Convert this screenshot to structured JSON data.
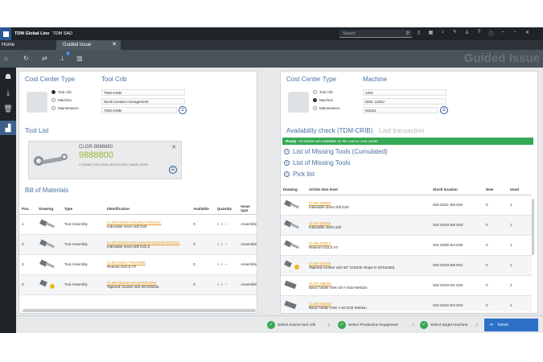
{
  "window": {
    "app_title": "TDM Global Line",
    "app_subtitle": "TDM SAD",
    "search_placeholder": "Search"
  },
  "tabs": {
    "home": "Home",
    "active": "Guided Issue",
    "active_close": "✕"
  },
  "toolbar": {
    "page_title": "Guided Issue",
    "badge": "1"
  },
  "left": {
    "cost_center_heading": "Cost Center Type",
    "tool_crib_heading": "Tool Crib",
    "radio_options": [
      "Tool crib",
      "Machine",
      "Maintenance"
    ],
    "selected_radio": 0,
    "fields": [
      "TDM-CRIB",
      "Stock location management",
      "TDM-CRIB"
    ],
    "tool_list_heading": "Tool List",
    "tool_list": {
      "code": "CLGR-9888880",
      "number": "9888800",
      "description": "CONNECTING ROD MERCEDES OM651 W204",
      "close": "✕"
    },
    "bom_heading": "Bill of Materials",
    "bom_columns": [
      "Pos.",
      "Drawing",
      "Type",
      "Identification",
      "Available",
      "Quantity",
      "Issue type"
    ],
    "bom_rows": [
      {
        "pos": "1",
        "type": "Tool Assembly",
        "id_link": "CLGR-D0015-HOLEPLATEDRILL",
        "id_desc": "Indexable insert drill D28",
        "available": "0",
        "qty": "1",
        "issue": "Assemble"
      },
      {
        "pos": "2",
        "type": "Tool Assembly",
        "id_link": "CLGR-D0016-EXCHANGEABLEHEADDRILL",
        "id_desc": "Indexable insert drill D31.5",
        "available": "0",
        "qty": "1",
        "issue": "Assemble"
      },
      {
        "pos": "3",
        "type": "Tool Assembly",
        "id_link": "CLGR-D0017-REAMER",
        "id_desc": "Reamer D31.5 H7",
        "available": "0",
        "qty": "1",
        "issue": "Assemble"
      },
      {
        "pos": "4",
        "type": "Tool Assembly",
        "id_link": "CLGR-D0018-COUNTERSINK",
        "id_desc": "Tapered counter sink 90 DIN335",
        "available": "0",
        "qty": "1",
        "issue": "Assemble"
      }
    ]
  },
  "right": {
    "cost_center_heading": "Cost Center Type",
    "machine_heading": "Machine",
    "radio_options": [
      "Tool crib",
      "Machine",
      "Maintenance"
    ],
    "selected_radio": 1,
    "fields": [
      "1001",
      "DMC 1150V",
      "M1001"
    ],
    "availability_heading": "Availability check (TDM-CRIB)",
    "last_transaction": "Last transaction",
    "ready_label": "Ready",
    "ready_text": "All articles are available on the source cost centre",
    "missing_cumulated": "List of Missing Tools (Cumulated)",
    "missing": "List of Missing Tools",
    "pick_list": "Pick list",
    "pick_columns": [
      "Drawing",
      "Article item level",
      "Stock location",
      "New",
      "Used"
    ],
    "pick_rows": [
      {
        "link": "CLGR-D0015",
        "desc": "Indexable insert drill D28",
        "loc": "S02 D021 W5 D04",
        "new": "0",
        "used": "1"
      },
      {
        "link": "CLGR-D0016",
        "desc": "Indexable insert drill",
        "loc": "S02 D048 W8 D03",
        "new": "0",
        "used": "1"
      },
      {
        "link": "CLGR-D0017",
        "desc": "Reamer D31.5 H7",
        "loc": "S01 D006 W4 D05",
        "new": "0",
        "used": "1"
      },
      {
        "link": "CLGR-D0018",
        "desc": "Tapered counter sink 90° DIN335 shape D (DIN2288)",
        "loc": "S02 D049 W9 D01",
        "new": "0",
        "used": "1"
      },
      {
        "link": "CLGR-HB006",
        "desc": "Basic holder HSK 63-A-D32-Weldon",
        "loc": "S02 D010 W1 D02",
        "new": "0",
        "used": "2"
      },
      {
        "link": "CLGR-HB003",
        "desc": "Basic holder HSK-A 63 D25 Weldon",
        "loc": "S02 D042 W4 D04",
        "new": "0",
        "used": "1"
      }
    ]
  },
  "steps": [
    "Select source tool crib",
    "Select Production Equipment",
    "Select target machine"
  ],
  "issue_button": "Issue",
  "colors": {
    "accent": "#2e6fc7",
    "ready": "#34a853",
    "link": "#e29a21",
    "heading": "#4a6fa5"
  }
}
